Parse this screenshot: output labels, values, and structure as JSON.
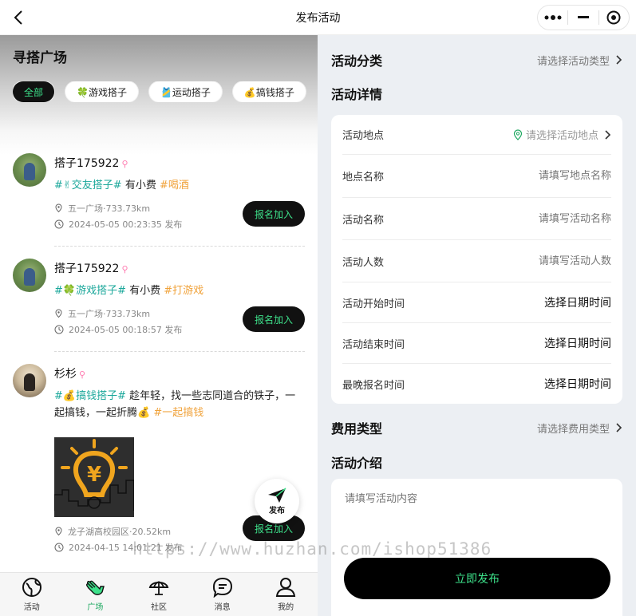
{
  "colors": {
    "accent_green": "#3de08a",
    "tag_teal": "#1aa79a",
    "tag_orange": "#f0a23a",
    "dark": "#111111"
  },
  "nav": {
    "title": "发布活动",
    "back_icon": "chevron-left-icon",
    "more_icon": "dots-icon",
    "minimize_icon": "minus-icon",
    "close_icon": "target-icon"
  },
  "plaza": {
    "title": "寻搭广场",
    "chips": [
      {
        "label": "全部"
      },
      {
        "label": "🍀游戏搭子"
      },
      {
        "label": "🎽运动搭子"
      },
      {
        "label": "💰搞钱搭子"
      }
    ],
    "posts": [
      {
        "name": "搭子175922",
        "tag": "#✌交友搭子#",
        "text": " 有小费 ",
        "tag2": "#喝酒",
        "location": "五一广场·733.73km",
        "time": "2024-05-05 00:23:35 发布",
        "button": "报名加入"
      },
      {
        "name": "搭子175922",
        "tag": "#🍀游戏搭子#",
        "text": " 有小费 ",
        "tag2": "#打游戏",
        "location": "五一广场·733.73km",
        "time": "2024-05-05 00:18:57 发布",
        "button": "报名加入"
      },
      {
        "name": "杉杉",
        "tag": "#💰搞钱搭子#",
        "text": " 趁年轻，找一些志同道合的铁子，一起搞钱，一起折腾💰 ",
        "tag2": "#一起搞钱",
        "location": "龙子湖高校园区·20.52km",
        "time": "2024-04-15 14:01:21 发布",
        "button": "报名加入"
      }
    ],
    "fab_label": "发布"
  },
  "tabbar": [
    {
      "label": "活动",
      "icon": "globe-icon"
    },
    {
      "label": "广场",
      "icon": "hand-wave-icon"
    },
    {
      "label": "社区",
      "icon": "umbrella-icon"
    },
    {
      "label": "消息",
      "icon": "chat-bubble-icon"
    },
    {
      "label": "我的",
      "icon": "user-icon"
    }
  ],
  "watermark": "https://www.huzhan.com/ishop51386",
  "form": {
    "category": {
      "title": "活动分类",
      "placeholder": "请选择活动类型"
    },
    "details_title": "活动详情",
    "fields": [
      {
        "label": "活动地点",
        "value": "请选择活动地点"
      },
      {
        "label": "地点名称",
        "placeholder": "请填写地点名称"
      },
      {
        "label": "活动名称",
        "placeholder": "请填写活动名称"
      },
      {
        "label": "活动人数",
        "placeholder": "请填写活动人数"
      },
      {
        "label": "活动开始时间",
        "value": "选择日期时间"
      },
      {
        "label": "活动结束时间",
        "value": "选择日期时间"
      },
      {
        "label": "最晚报名时间",
        "value": "选择日期时间"
      }
    ],
    "fee": {
      "title": "费用类型",
      "placeholder": "请选择费用类型"
    },
    "intro": {
      "title": "活动介绍",
      "placeholder": "请填写活动内容"
    },
    "submit": "立即发布"
  }
}
